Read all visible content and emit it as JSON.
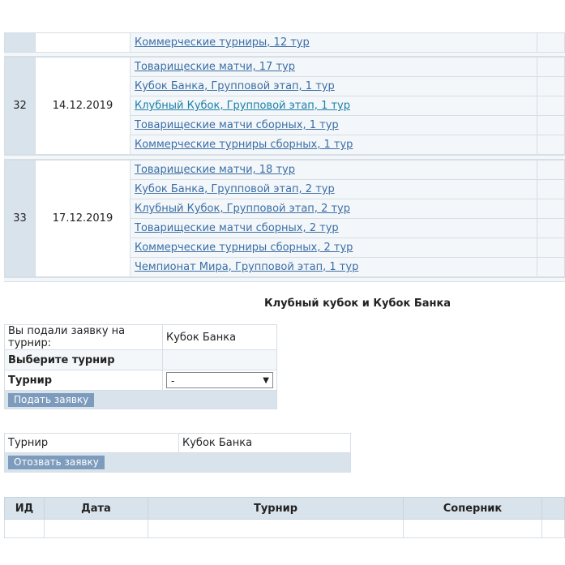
{
  "schedule": {
    "top_partial": {
      "link": "Коммерческие турниры, 12 тур"
    },
    "rounds": [
      {
        "num": "32",
        "date": "14.12.2019",
        "links": [
          "Товарищеские матчи, 17 тур",
          "Кубок Банка, Групповой этап, 1 тур",
          "Клубный Кубок, Групповой этап, 1 тур",
          "Товарищеские матчи сборных, 1 тур",
          "Коммерческие турниры сборных, 1 тур"
        ]
      },
      {
        "num": "33",
        "date": "17.12.2019",
        "links": [
          "Товарищеские матчи, 18 тур",
          "Кубок Банка, Групповой этап, 2 тур",
          "Клубный Кубок, Групповой этап, 2 тур",
          "Товарищеские матчи сборных, 2 тур",
          "Коммерческие турниры сборных, 2 тур",
          "Чемпионат Мира, Групповой этап, 1 тур"
        ]
      }
    ]
  },
  "section_title": "Клубный кубок и Кубок Банка",
  "apply_form": {
    "applied_label": "Вы подали заявку на турнир:",
    "applied_value": "Кубок Банка",
    "choose_label": "Выберите турнир",
    "tournament_label": "Турнир",
    "select_value": "-",
    "submit_label": "Подать заявку"
  },
  "withdraw_form": {
    "tournament_label": "Турнир",
    "tournament_value": "Кубок Банка",
    "withdraw_label": "Отозвать заявку"
  },
  "games_table": {
    "headers": [
      "ИД",
      "Дата",
      "Турнир",
      "Соперник"
    ]
  }
}
